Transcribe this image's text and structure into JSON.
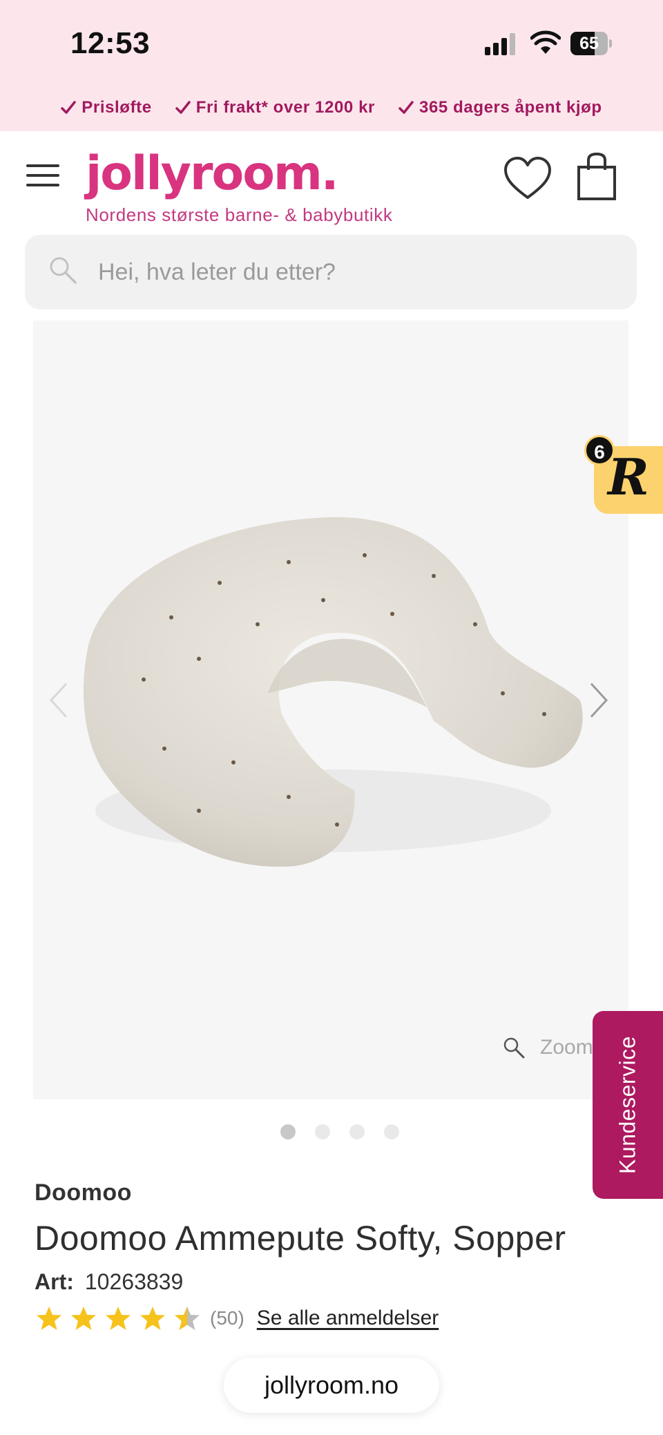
{
  "status_bar": {
    "time": "12:53",
    "battery": "65",
    "battery_level": 0.65
  },
  "usp_bar": {
    "items": [
      "Prisløfte",
      "Fri frakt* over 1200 kr",
      "365 dagers åpent kjøp"
    ]
  },
  "header": {
    "logo": "jollyroom.",
    "tagline": "Nordens største barne- & babybutikk",
    "menu_icon": "hamburger-menu-icon",
    "wishlist_icon": "heart-icon",
    "cart_icon": "shopping-bag-icon"
  },
  "search": {
    "placeholder": "Hei, hva leter du etter?"
  },
  "gallery": {
    "zoom_label": "Zoom",
    "image_count": 4,
    "active_index": 0
  },
  "review_badge": {
    "letter": "R",
    "count": "6"
  },
  "customer_service": {
    "label": "Kundeservice"
  },
  "product": {
    "brand": "Doomoo",
    "title": "Doomoo Ammepute Softy, Sopper",
    "art_label": "Art:",
    "art_number": "10263839",
    "rating": 4.5,
    "review_count": "(50)",
    "reviews_link": "Se alle anmeldelser"
  },
  "browser": {
    "url": "jollyroom.no"
  },
  "colors": {
    "brand_pink": "#d8347f",
    "usp_text": "#a1195e",
    "usp_bg": "#fce6ec",
    "customer_service_bg": "#ad1a5f",
    "star": "#f6c21c",
    "review_badge_bg": "#fcd26e"
  }
}
